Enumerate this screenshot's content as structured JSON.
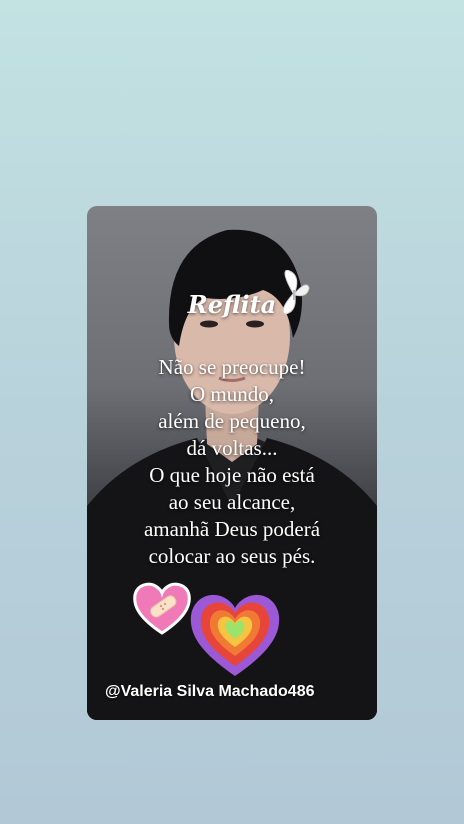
{
  "post": {
    "title": "Reflita",
    "message_lines": [
      "Não se preocupe!",
      "O mundo,",
      "além de pequeno,",
      "dá voltas...",
      "O que hoje não está",
      "ao seu alcance,",
      "amanhã Deus poderá",
      "colocar ao seus pés."
    ],
    "signature": "@Valeria Silva Machado486"
  },
  "colors": {
    "background_top": "#c3e2e2",
    "background_bottom": "#b2c8d6",
    "text": "#ffffff",
    "bandage_heart": "#f07ab8",
    "rainbow_outer": "#9b59d6",
    "rainbow_center": "#9be36a"
  },
  "icons": [
    "butterfly-icon",
    "bandaged-heart-sticker",
    "rainbow-heart-sticker"
  ]
}
